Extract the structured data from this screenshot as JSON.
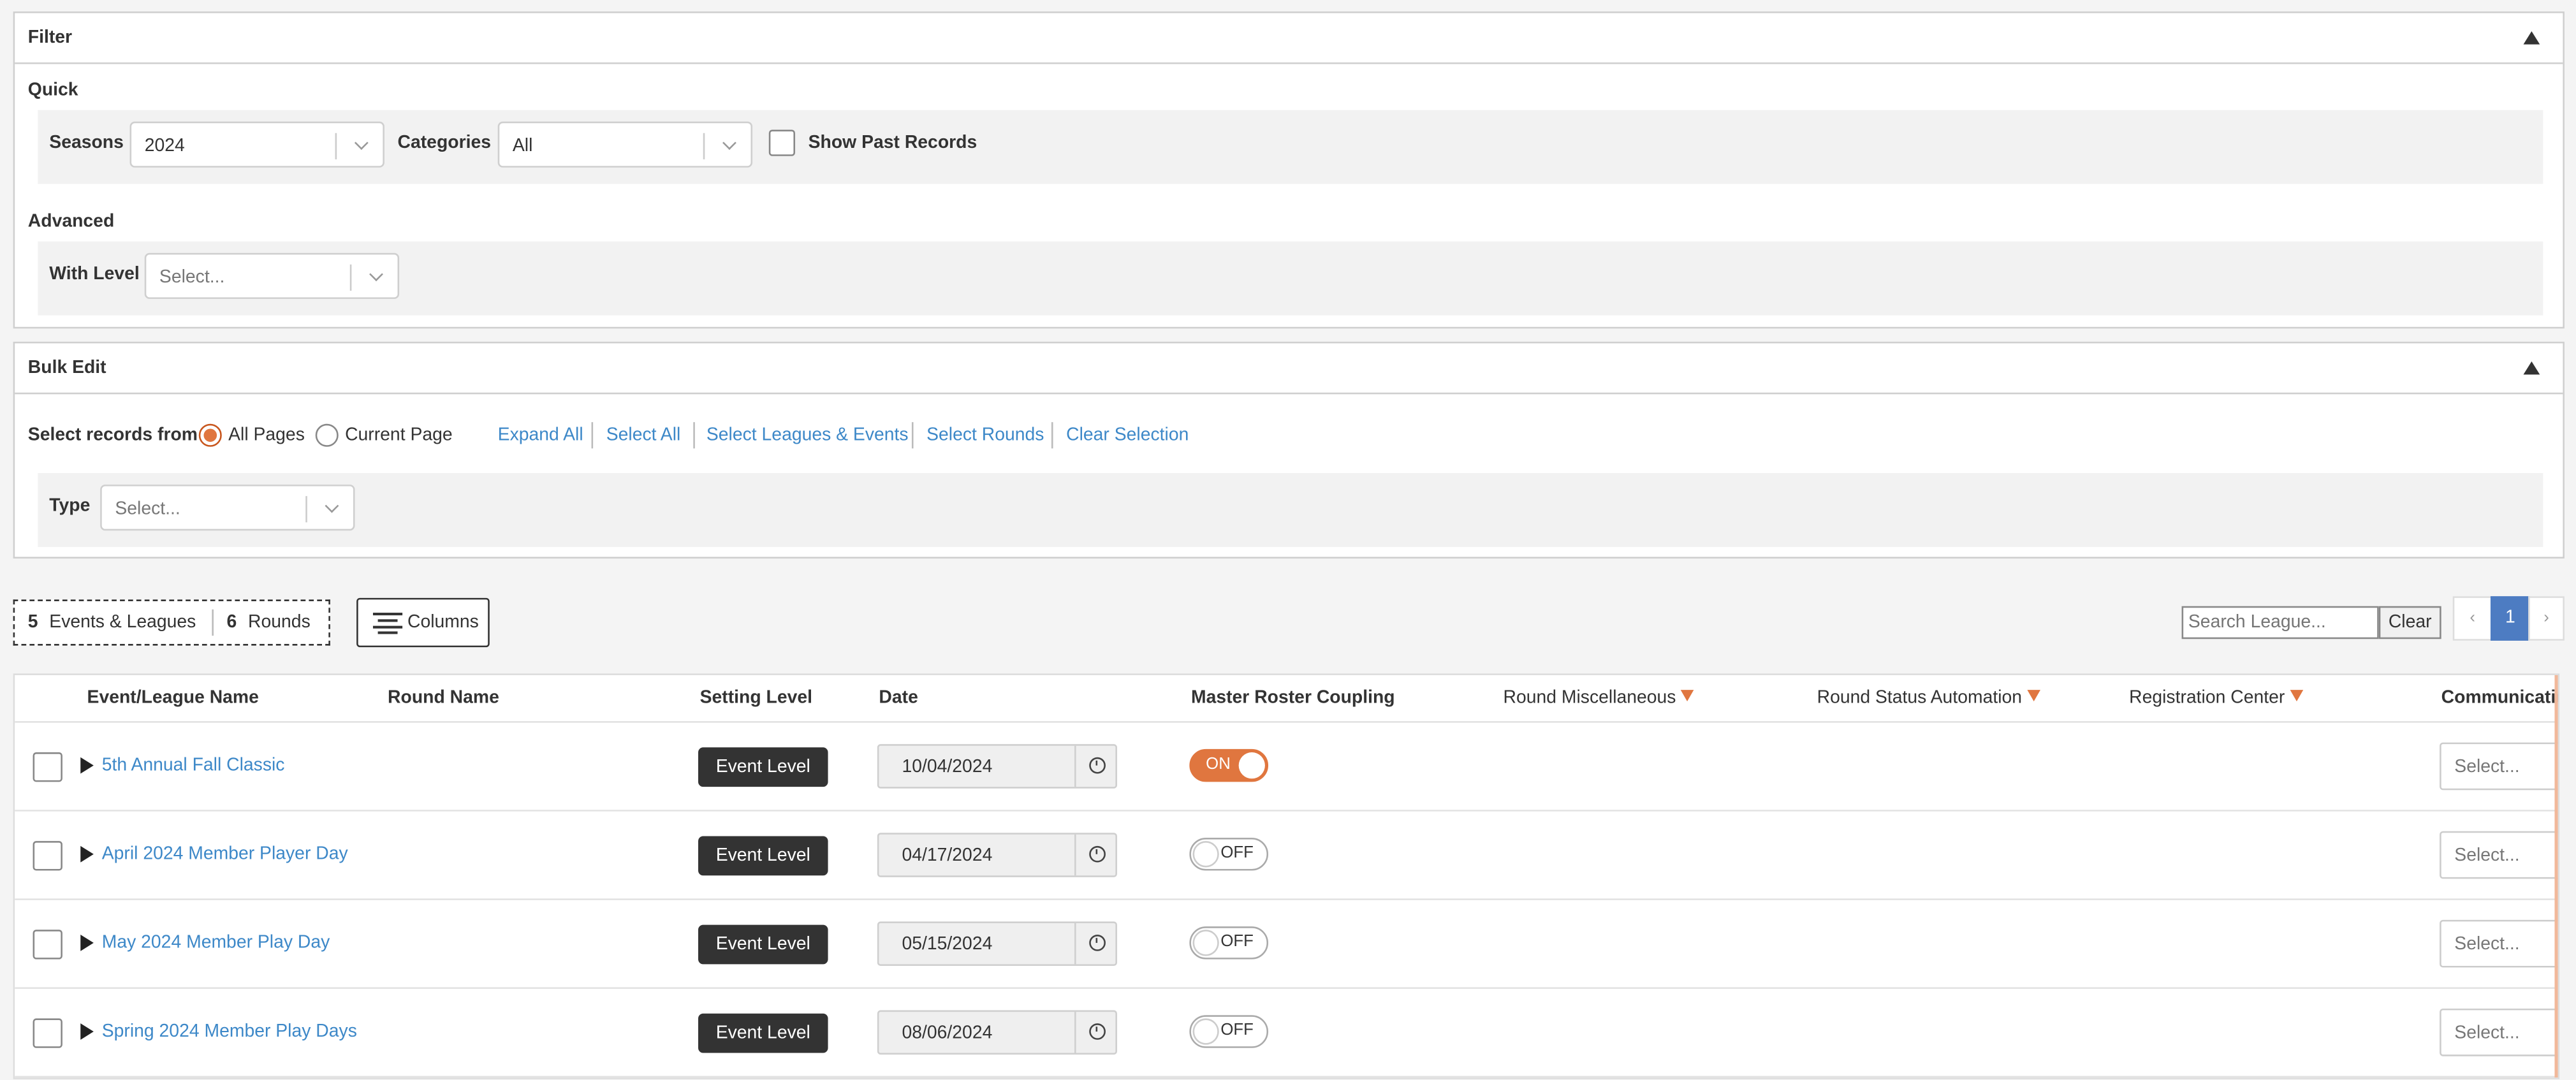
{
  "filter": {
    "title": "Filter",
    "quick_label": "Quick",
    "seasons_label": "Seasons",
    "seasons_value": "2024",
    "categories_label": "Categories",
    "categories_value": "All",
    "show_past_label": "Show Past Records",
    "show_past_checked": false,
    "advanced_label": "Advanced",
    "with_level_label": "With Level",
    "with_level_placeholder": "Select..."
  },
  "bulk_edit": {
    "title": "Bulk Edit",
    "select_from_label": "Select records from",
    "options": [
      "All Pages",
      "Current Page"
    ],
    "selected_option": "All Pages",
    "actions": [
      "Expand All",
      "Select All",
      "Select Leagues & Events",
      "Select Rounds",
      "Clear Selection"
    ],
    "type_label": "Type",
    "type_placeholder": "Select..."
  },
  "toolbar": {
    "events_count": "5",
    "events_label": "Events & Leagues",
    "rounds_count": "6",
    "rounds_label": "Rounds",
    "columns_label": "Columns",
    "search_placeholder": "Search League...",
    "clear_label": "Clear",
    "prev": "‹",
    "page": "1",
    "next": "›"
  },
  "table": {
    "columns": [
      "Event/League Name",
      "Round Name",
      "Setting Level",
      "Date",
      "Master Roster Coupling",
      "Round Miscellaneous",
      "Round Status Automation",
      "Registration Center",
      "Communication"
    ],
    "rows": [
      {
        "name": "5th Annual Fall Classic",
        "level": "Event Level",
        "date": "10/04/2024",
        "coupling": "ON",
        "comm": "Select..."
      },
      {
        "name": "April 2024 Member Player Day",
        "level": "Event Level",
        "date": "04/17/2024",
        "coupling": "OFF",
        "comm": "Select..."
      },
      {
        "name": "May 2024 Member Play Day",
        "level": "Event Level",
        "date": "05/15/2024",
        "coupling": "OFF",
        "comm": "Select..."
      },
      {
        "name": "Spring 2024 Member Play Days",
        "level": "Event Level",
        "date": "08/06/2024",
        "coupling": "OFF",
        "comm": "Select..."
      }
    ]
  },
  "colors": {
    "accent": "#e0763f",
    "link": "#3d88c8",
    "pager_active": "#4d7cc2",
    "dark_button": "#333333"
  }
}
